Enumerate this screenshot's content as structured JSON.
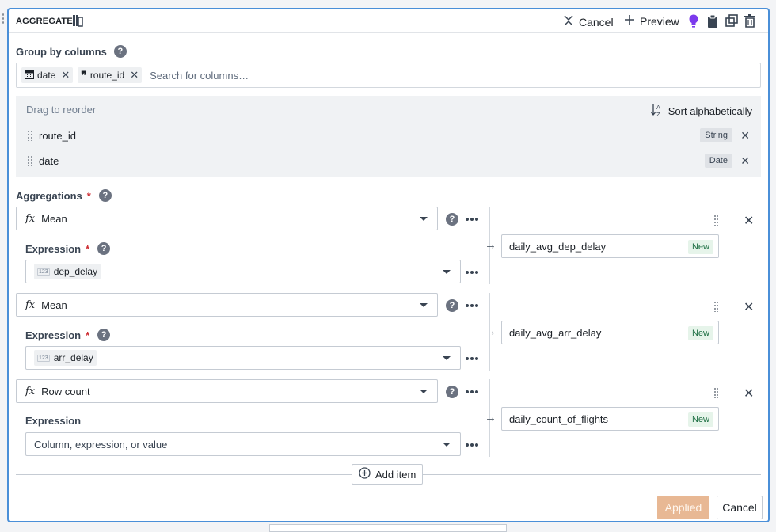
{
  "header": {
    "title": "AGGREGATE",
    "cancel_label": "Cancel",
    "preview_label": "Preview"
  },
  "group_by": {
    "label": "Group by columns",
    "chips": [
      {
        "label": "date",
        "icon": "calendar-icon"
      },
      {
        "label": "route_id",
        "icon": "quote-icon"
      }
    ],
    "placeholder": "Search for columns…"
  },
  "reorder": {
    "hint": "Drag to reorder",
    "sort_label": "Sort alphabetically",
    "rows": [
      {
        "name": "route_id",
        "type": "String"
      },
      {
        "name": "date",
        "type": "Date"
      }
    ]
  },
  "aggregations": {
    "label": "Aggregations",
    "required_mark": "*",
    "items": [
      {
        "function": "Mean",
        "expression_label": "Expression",
        "required": true,
        "expression_value": "dep_delay",
        "output": "daily_avg_dep_delay",
        "badge": "New"
      },
      {
        "function": "Mean",
        "expression_label": "Expression",
        "required": true,
        "expression_value": "arr_delay",
        "output": "daily_avg_arr_delay",
        "badge": "New"
      },
      {
        "function": "Row count",
        "expression_label": "Expression",
        "required": false,
        "expression_placeholder": "Column, expression, or value",
        "output": "daily_count_of_flights",
        "badge": "New"
      }
    ],
    "add_label": "Add item",
    "fx_symbol": "fx",
    "numeric_type_icon": "123"
  },
  "footer": {
    "applied_label": "Applied",
    "cancel_label": "Cancel"
  },
  "colors": {
    "panel_border": "#4a8fd8",
    "applied_bg": "#e8b894",
    "new_badge_bg": "#e6f4ea",
    "lightbulb": "#7c3aed"
  }
}
